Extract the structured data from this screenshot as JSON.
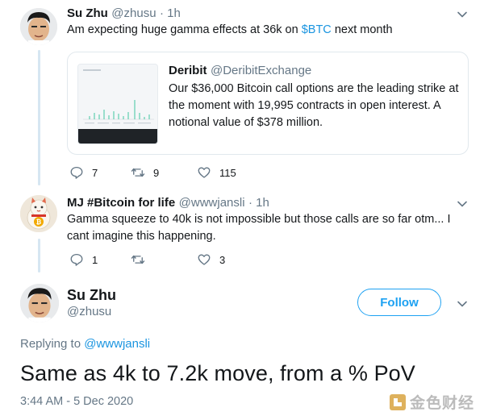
{
  "tweet1": {
    "name": "Su Zhu",
    "handle": "@zhusu",
    "time": "· 1h",
    "text_before": "Am expecting huge gamma effects at 36k on ",
    "cashtag": "$BTC",
    "text_after": " next month",
    "quote": {
      "name": "Deribit",
      "handle": "@DeribitExchange",
      "text": "Our $36,000 Bitcoin call options are the leading strike at the moment with 19,995 contracts in open interest. A notional value of $378 million."
    },
    "replies": "7",
    "retweets": "9",
    "likes": "115"
  },
  "tweet2": {
    "name": "MJ #Bitcoin for life",
    "handle": "@wwwjansli",
    "time": "· 1h",
    "text": "Gamma squeeze to 40k is not impossible but those calls are so far otm... I cant imagine this happening.",
    "replies": "1",
    "retweets": "",
    "likes": "3"
  },
  "main": {
    "name": "Su Zhu",
    "handle": "@zhusu",
    "follow_label": "Follow",
    "replying_to_label": "Replying to",
    "replying_to_handle": "@wwwjansli",
    "text": "Same as 4k to 7.2k move, from a % PoV",
    "timestamp": "3:44 AM - 5 Dec 2020"
  },
  "watermark": {
    "text": "金色财经"
  },
  "colors": {
    "accent": "#1da1f2",
    "link": "#1b95e0",
    "muted": "#657786",
    "thread": "#d6e6f2"
  }
}
